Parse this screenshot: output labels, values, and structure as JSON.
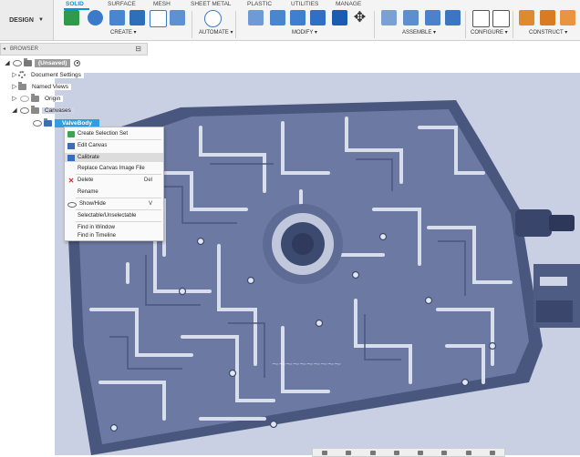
{
  "workspace": {
    "label": "DESIGN"
  },
  "tabs": [
    {
      "label": "SOLID",
      "active": true
    },
    {
      "label": "SURFACE"
    },
    {
      "label": "MESH"
    },
    {
      "label": "SHEET METAL"
    },
    {
      "label": "PLASTIC"
    },
    {
      "label": "UTILITIES"
    },
    {
      "label": "MANAGE"
    }
  ],
  "groups": {
    "create": "CREATE ▾",
    "automate": "AUTOMATE ▾",
    "modify": "MODIFY ▾",
    "assemble": "ASSEMBLE ▾",
    "configure": "CONFIGURE ▾",
    "construct": "CONSTRUCT ▾"
  },
  "browser": {
    "title": "BROWSER",
    "root": "(Unsaved)",
    "items": [
      "Document Settings",
      "Named Views",
      "Origin",
      "Canvases"
    ],
    "selected": "ValveBody"
  },
  "context_menu": {
    "items": [
      {
        "label": "Create Selection Set",
        "shortcut": ""
      },
      {
        "label": "Edit Canvas",
        "shortcut": ""
      },
      {
        "label": "Calibrate",
        "shortcut": "",
        "highlighted": true
      },
      {
        "label": "Replace Canvas Image File",
        "shortcut": ""
      },
      {
        "label": "Delete",
        "shortcut": "Del"
      },
      {
        "label": "Rename",
        "shortcut": ""
      },
      {
        "label": "Show/Hide",
        "shortcut": "V"
      },
      {
        "label": "Selectable/Unselectable",
        "shortcut": ""
      },
      {
        "label": "Find in Window",
        "shortcut": ""
      },
      {
        "label": "Find in Timeline",
        "shortcut": ""
      }
    ]
  },
  "colors": {
    "accent": "#0696d7",
    "selection": "#2e9fe0",
    "canvas_tint": "#c9d0e3"
  }
}
